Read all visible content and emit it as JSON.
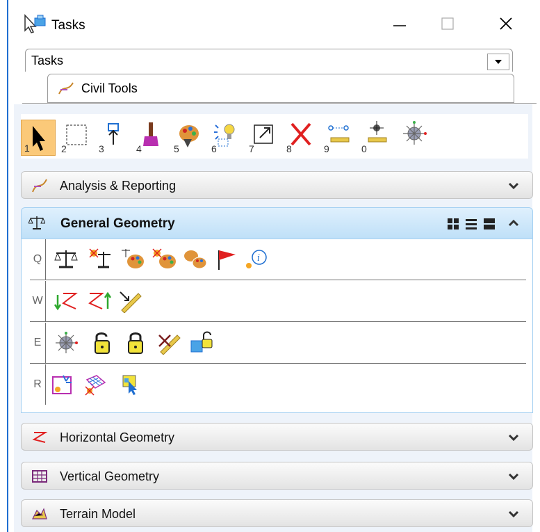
{
  "window": {
    "title": "Tasks",
    "minimize_glyph": "—",
    "maximize_glyph": "□",
    "close_glyph": "✕"
  },
  "tabs": {
    "outer_label": "Tasks",
    "inner_label": "Civil Tools"
  },
  "toolbar": {
    "tools": [
      {
        "num": "1",
        "icon": "select-arrow-icon"
      },
      {
        "num": "2",
        "icon": "selection-rectangle-icon"
      },
      {
        "num": "3",
        "icon": "place-element-icon"
      },
      {
        "num": "4",
        "icon": "paint-brush-icon"
      },
      {
        "num": "5",
        "icon": "palette-icon"
      },
      {
        "num": "6",
        "icon": "light-bulb-icon"
      },
      {
        "num": "7",
        "icon": "scale-icon"
      },
      {
        "num": "8",
        "icon": "delete-x-icon"
      },
      {
        "num": "9",
        "icon": "measure-icon"
      },
      {
        "num": "0",
        "icon": "crosshair-measure-icon"
      },
      {
        "num": "",
        "icon": "snap-icon"
      }
    ]
  },
  "groups": {
    "analysis": {
      "label": "Analysis & Reporting"
    },
    "general": {
      "label": "General Geometry"
    },
    "horizontal": {
      "label": "Horizontal Geometry"
    },
    "vertical": {
      "label": "Vertical Geometry"
    },
    "terrain": {
      "label": "Terrain Model"
    }
  },
  "general_rows": [
    {
      "key": "Q",
      "tools": [
        "balance-icon",
        "balance-spark-icon",
        "balance-palette-icon",
        "palette-spark-icon",
        "palette-pair-icon",
        "flag-icon",
        "info-spark-icon"
      ]
    },
    {
      "key": "W",
      "tools": [
        "zigzag-down-icon",
        "zigzag-up-icon",
        "ruler-arrow-icon"
      ]
    },
    {
      "key": "E",
      "tools": [
        "snap-point-icon",
        "open-lock-icon",
        "lock-icon",
        "ruler-cross-icon",
        "unlock-element-icon"
      ]
    },
    {
      "key": "R",
      "tools": [
        "highlight-point-icon",
        "mesh-spark-icon",
        "select-cursor-icon"
      ]
    }
  ],
  "colors": {
    "accent_blue": "#1f6fd1",
    "active_tool_orange": "#fbc979",
    "expanded_header_blue": "#cfe8fb"
  }
}
